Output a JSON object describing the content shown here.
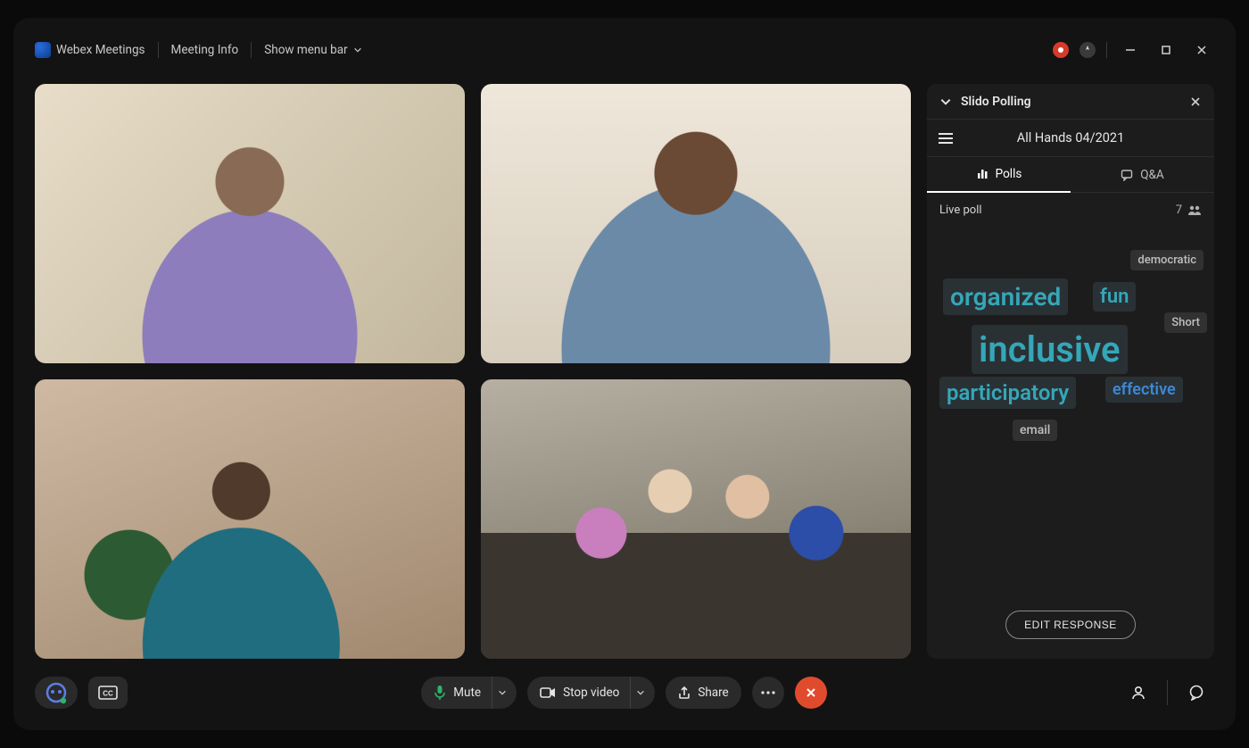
{
  "topbar": {
    "app_name": "Webex Meetings",
    "meeting_info": "Meeting Info",
    "show_menu": "Show menu bar"
  },
  "sidebar": {
    "panel_name": "Slido Polling",
    "meeting_title": "All Hands 04/2021",
    "tabs": {
      "polls": "Polls",
      "qa": "Q&A"
    },
    "live_label": "Live poll",
    "participant_count": "7",
    "words": {
      "democratic": "democratic",
      "organized": "organized",
      "fun": "fun",
      "short": "Short",
      "inclusive": "inclusive",
      "participatory": "participatory",
      "effective": "effective",
      "email": "email"
    },
    "edit_label": "EDIT RESPONSE"
  },
  "controls": {
    "mute": "Mute",
    "stop_video": "Stop video",
    "share": "Share"
  }
}
